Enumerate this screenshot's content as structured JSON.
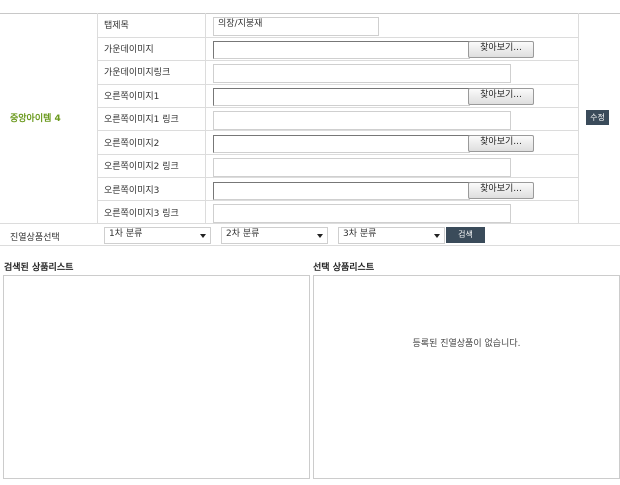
{
  "item_group": {
    "label": "중앙아이템 4",
    "label_color": "#6b9a1e"
  },
  "rows": [
    {
      "label": "탭제목",
      "type": "text",
      "value": "의장/지붕재"
    },
    {
      "label": "가운데이미지",
      "type": "file",
      "button": "찾아보기..."
    },
    {
      "label": "가운데이미지링크",
      "type": "text",
      "value": ""
    },
    {
      "label": "오른쪽이미지1",
      "type": "file",
      "button": "찾아보기..."
    },
    {
      "label": "오른쪽이미지1 링크",
      "type": "text",
      "value": ""
    },
    {
      "label": "오른쪽이미지2",
      "type": "file",
      "button": "찾아보기..."
    },
    {
      "label": "오른쪽이미지2 링크",
      "type": "text",
      "value": ""
    },
    {
      "label": "오른쪽이미지3",
      "type": "file",
      "button": "찾아보기..."
    },
    {
      "label": "오른쪽이미지3 링크",
      "type": "text",
      "value": ""
    }
  ],
  "edit_button": "수정",
  "display_select": {
    "label": "진열상품선택",
    "selects": [
      "1차 분류",
      "2차 분류",
      "3차 분류"
    ],
    "search_button": "검색"
  },
  "searched_list": {
    "title": "검색된 상품리스트"
  },
  "selected_list": {
    "title": "선택 상품리스트",
    "empty_message": "등록된 진열상품이 없습니다."
  },
  "colors": {
    "accent_green": "#6b9a1e",
    "dark_button": "#3a4b5a",
    "border": "#dcdcdc"
  }
}
